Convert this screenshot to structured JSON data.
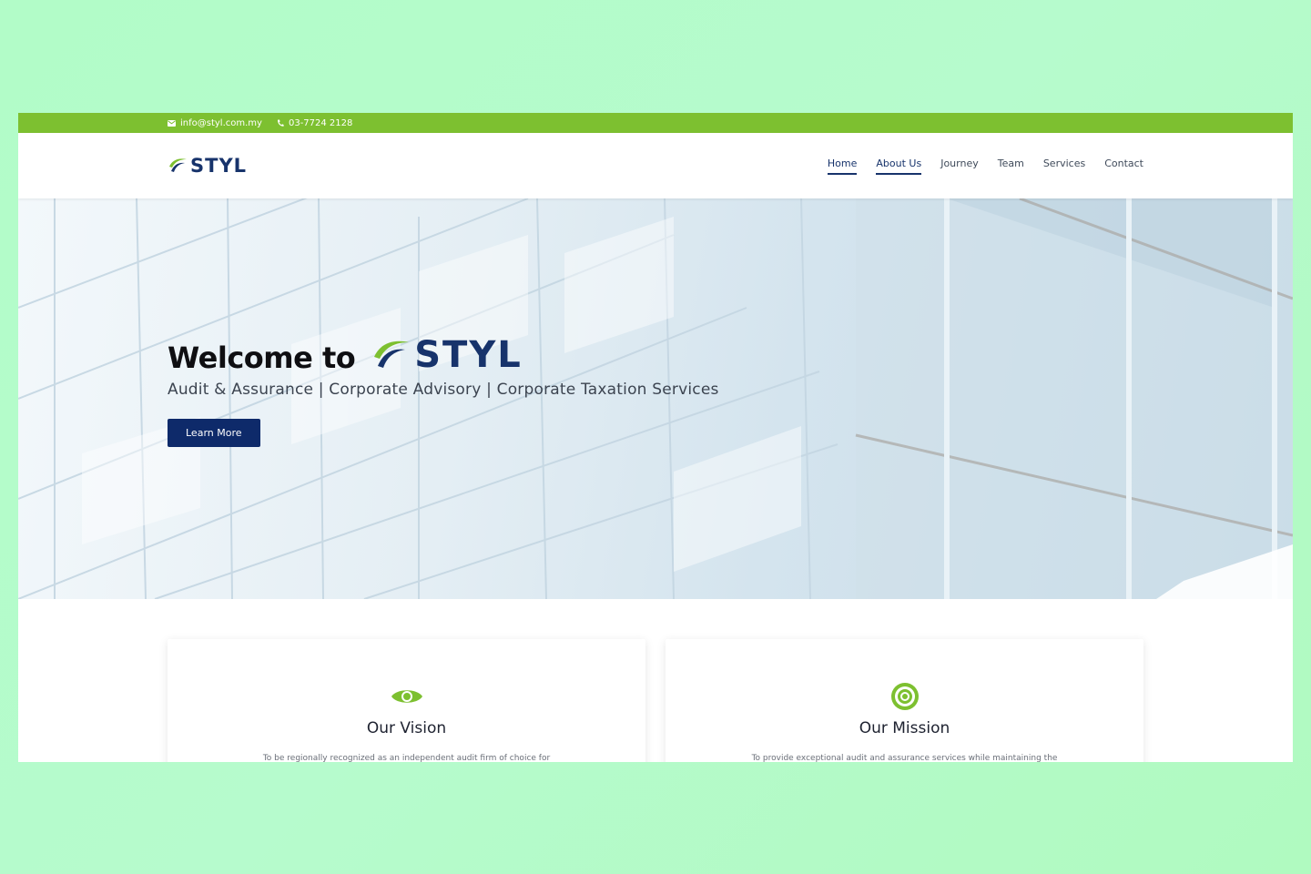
{
  "topbar": {
    "email": "info@styl.com.my",
    "phone": "03-7724 2128",
    "icons": [
      "envelope-icon",
      "phone-icon"
    ]
  },
  "header": {
    "logo_text": "STYL",
    "nav": [
      {
        "label": "Home",
        "active": true
      },
      {
        "label": "About Us",
        "active": true
      },
      {
        "label": "Journey",
        "active": false
      },
      {
        "label": "Team",
        "active": false
      },
      {
        "label": "Services",
        "active": false
      },
      {
        "label": "Contact",
        "active": false
      }
    ]
  },
  "hero": {
    "title": "Welcome to",
    "logo_text": "STYL",
    "subtitle": "Audit & Assurance | Corporate Advisory | Corporate Taxation Services",
    "button_label": "Learn More"
  },
  "cards": [
    {
      "icon": "eye-icon",
      "title": "Our Vision",
      "text": "To be regionally recognized as an independent audit firm of choice for"
    },
    {
      "icon": "target-icon",
      "title": "Our Mission",
      "text": "To provide exceptional audit and assurance services while maintaining the"
    }
  ],
  "colors": {
    "accent_green": "#7dc030",
    "brand_navy": "#17336b",
    "button_navy": "#0e2a6a",
    "page_background": "#b4fbc8"
  }
}
